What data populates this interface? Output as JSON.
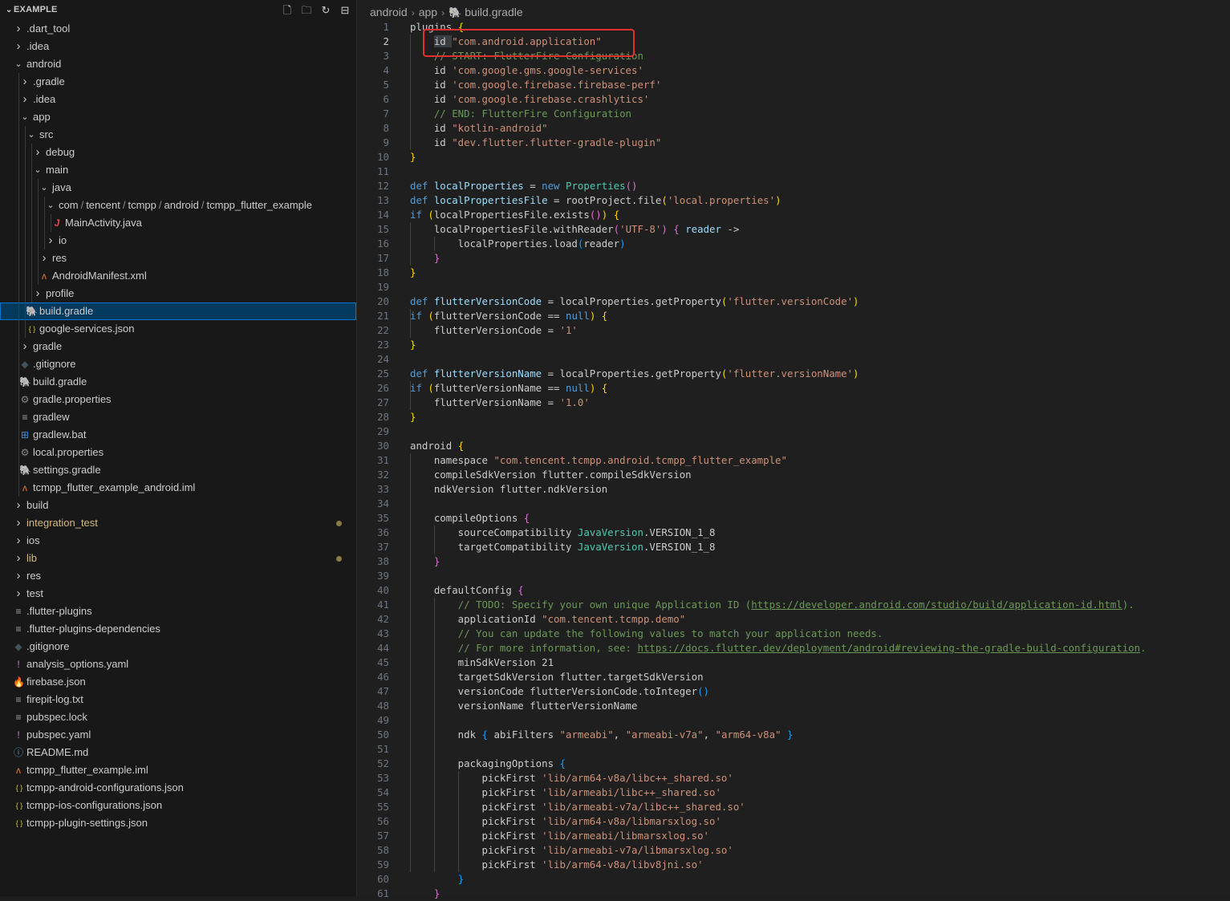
{
  "explorer": {
    "title": "EXAMPLE",
    "toolbar": [
      {
        "name": "new-file-icon",
        "glyph": "🗋"
      },
      {
        "name": "new-folder-icon",
        "glyph": "🗀"
      },
      {
        "name": "refresh-icon",
        "glyph": "↻"
      },
      {
        "name": "collapse-all-icon",
        "glyph": "⊟"
      }
    ],
    "items": [
      {
        "label": ".dart_tool",
        "kind": "folder",
        "expanded": false,
        "depth": 0
      },
      {
        "label": ".idea",
        "kind": "folder",
        "expanded": false,
        "depth": 0
      },
      {
        "label": "android",
        "kind": "folder",
        "expanded": true,
        "depth": 0
      },
      {
        "label": ".gradle",
        "kind": "folder",
        "expanded": false,
        "depth": 1
      },
      {
        "label": ".idea",
        "kind": "folder",
        "expanded": false,
        "depth": 1
      },
      {
        "label": "app",
        "kind": "folder",
        "expanded": true,
        "depth": 1
      },
      {
        "label": "src",
        "kind": "folder",
        "expanded": true,
        "depth": 2
      },
      {
        "label": "debug",
        "kind": "folder",
        "expanded": false,
        "depth": 3
      },
      {
        "label": "main",
        "kind": "folder",
        "expanded": true,
        "depth": 3
      },
      {
        "label": "java",
        "kind": "folder",
        "expanded": true,
        "depth": 4
      },
      {
        "label": "com / tencent / tcmpp / android / tcmpp_flutter_example",
        "kind": "folder",
        "expanded": true,
        "depth": 5
      },
      {
        "label": "MainActivity.java",
        "kind": "file",
        "icon": "java-icon",
        "glyph": "J",
        "color": "#e2494f",
        "depth": 6
      },
      {
        "label": "io",
        "kind": "folder",
        "expanded": false,
        "depth": 5
      },
      {
        "label": "res",
        "kind": "folder",
        "expanded": false,
        "depth": 4
      },
      {
        "label": "AndroidManifest.xml",
        "kind": "file",
        "icon": "rss-xml-icon",
        "glyph": "ʌ",
        "color": "#e37933",
        "depth": 4
      },
      {
        "label": "profile",
        "kind": "folder",
        "expanded": false,
        "depth": 3
      },
      {
        "label": "build.gradle",
        "kind": "file",
        "icon": "gradle-elephant-icon",
        "glyph": "🐘",
        "color": "#5b9bd5",
        "depth": 2,
        "selected": true
      },
      {
        "label": "google-services.json",
        "kind": "file",
        "icon": "json-braces-icon",
        "glyph": "{ }",
        "color": "#cbcb41",
        "depth": 2
      },
      {
        "label": "gradle",
        "kind": "folder",
        "expanded": false,
        "depth": 1
      },
      {
        "label": ".gitignore",
        "kind": "file",
        "icon": "git-diamond-icon",
        "glyph": "◆",
        "color": "#41535b",
        "depth": 1
      },
      {
        "label": "build.gradle",
        "kind": "file",
        "icon": "gradle-elephant-icon",
        "glyph": "🐘",
        "color": "#5b9bd5",
        "depth": 1
      },
      {
        "label": "gradle.properties",
        "kind": "file",
        "icon": "gear-icon",
        "glyph": "⚙",
        "color": "#8a8a8a",
        "depth": 1
      },
      {
        "label": "gradlew",
        "kind": "file",
        "icon": "text-lines-icon",
        "glyph": "≡",
        "color": "#a0a0a0",
        "depth": 1
      },
      {
        "label": "gradlew.bat",
        "kind": "file",
        "icon": "windows-icon",
        "glyph": "⊞",
        "color": "#3b8ee0",
        "depth": 1
      },
      {
        "label": "local.properties",
        "kind": "file",
        "icon": "gear-icon",
        "glyph": "⚙",
        "color": "#8a8a8a",
        "depth": 1
      },
      {
        "label": "settings.gradle",
        "kind": "file",
        "icon": "gradle-elephant-icon",
        "glyph": "🐘",
        "color": "#5b9bd5",
        "depth": 1
      },
      {
        "label": "tcmpp_flutter_example_android.iml",
        "kind": "file",
        "icon": "rss-xml-icon",
        "glyph": "ʌ",
        "color": "#e37933",
        "depth": 1
      },
      {
        "label": "build",
        "kind": "folder",
        "expanded": false,
        "depth": 0
      },
      {
        "label": "integration_test",
        "kind": "folder",
        "expanded": false,
        "depth": 0,
        "modified": true
      },
      {
        "label": "ios",
        "kind": "folder",
        "expanded": false,
        "depth": 0
      },
      {
        "label": "lib",
        "kind": "folder",
        "expanded": false,
        "depth": 0,
        "modified": true
      },
      {
        "label": "res",
        "kind": "folder",
        "expanded": false,
        "depth": 0
      },
      {
        "label": "test",
        "kind": "folder",
        "expanded": false,
        "depth": 0
      },
      {
        "label": ".flutter-plugins",
        "kind": "file",
        "icon": "text-lines-icon",
        "glyph": "≡",
        "color": "#a0a0a0",
        "depth": 0
      },
      {
        "label": ".flutter-plugins-dependencies",
        "kind": "file",
        "icon": "text-lines-icon",
        "glyph": "≡",
        "color": "#a0a0a0",
        "depth": 0
      },
      {
        "label": ".gitignore",
        "kind": "file",
        "icon": "git-diamond-icon",
        "glyph": "◆",
        "color": "#41535b",
        "depth": 0
      },
      {
        "label": "analysis_options.yaml",
        "kind": "file",
        "icon": "yaml-exclamation-icon",
        "glyph": "!",
        "color": "#c678dd",
        "depth": 0
      },
      {
        "label": "firebase.json",
        "kind": "file",
        "icon": "firebase-flame-icon",
        "glyph": "🔥",
        "color": "#f5820d",
        "depth": 0
      },
      {
        "label": "firepit-log.txt",
        "kind": "file",
        "icon": "text-lines-icon",
        "glyph": "≡",
        "color": "#a0a0a0",
        "depth": 0
      },
      {
        "label": "pubspec.lock",
        "kind": "file",
        "icon": "text-lines-icon",
        "glyph": "≡",
        "color": "#a0a0a0",
        "depth": 0
      },
      {
        "label": "pubspec.yaml",
        "kind": "file",
        "icon": "yaml-exclamation-icon",
        "glyph": "!",
        "color": "#c678dd",
        "depth": 0
      },
      {
        "label": "README.md",
        "kind": "file",
        "icon": "info-icon",
        "glyph": "ⓘ",
        "color": "#519aba",
        "depth": 0
      },
      {
        "label": "tcmpp_flutter_example.iml",
        "kind": "file",
        "icon": "rss-xml-icon",
        "glyph": "ʌ",
        "color": "#e37933",
        "depth": 0
      },
      {
        "label": "tcmpp-android-configurations.json",
        "kind": "file",
        "icon": "json-braces-icon",
        "glyph": "{ }",
        "color": "#cbcb41",
        "depth": 0
      },
      {
        "label": "tcmpp-ios-configurations.json",
        "kind": "file",
        "icon": "json-braces-icon",
        "glyph": "{ }",
        "color": "#cbcb41",
        "depth": 0
      },
      {
        "label": "tcmpp-plugin-settings.json",
        "kind": "file",
        "icon": "json-braces-icon",
        "glyph": "{ }",
        "color": "#cbcb41",
        "depth": 0
      }
    ]
  },
  "breadcrumb": {
    "parts": [
      "android",
      "app"
    ],
    "file": "build.gradle",
    "file_icon": "gradle-elephant-icon"
  },
  "editor": {
    "active_line": 2,
    "highlighted_line": 2,
    "colors": {
      "highlight_box": "#e03030",
      "selection": "#04395e",
      "modified": "#d7ba7d"
    },
    "lines": [
      [
        [
          "t-plain",
          "plugins "
        ],
        [
          "t-b1",
          "{"
        ]
      ],
      [
        [
          "t-plain",
          "    "
        ],
        [
          "t-sel",
          "id "
        ],
        [
          "t-str",
          "\"com.android.application\""
        ]
      ],
      [
        [
          "t-plain",
          "    "
        ],
        [
          "t-com",
          "// START: FlutterFire Configuration"
        ]
      ],
      [
        [
          "t-plain",
          "    id "
        ],
        [
          "t-str",
          "'com.google.gms.google-services'"
        ]
      ],
      [
        [
          "t-plain",
          "    id "
        ],
        [
          "t-str",
          "'com.google.firebase.firebase-perf'"
        ]
      ],
      [
        [
          "t-plain",
          "    id "
        ],
        [
          "t-str",
          "'com.google.firebase.crashlytics'"
        ]
      ],
      [
        [
          "t-plain",
          "    "
        ],
        [
          "t-com",
          "// END: FlutterFire Configuration"
        ]
      ],
      [
        [
          "t-plain",
          "    id "
        ],
        [
          "t-str",
          "\"kotlin-android\""
        ]
      ],
      [
        [
          "t-plain",
          "    id "
        ],
        [
          "t-str",
          "\"dev.flutter.flutter-gradle-plugin\""
        ]
      ],
      [
        [
          "t-b1",
          "}"
        ]
      ],
      [],
      [
        [
          "t-kw",
          "def "
        ],
        [
          "t-var",
          "localProperties"
        ],
        [
          "t-plain",
          " = "
        ],
        [
          "t-kw",
          "new "
        ],
        [
          "t-cls",
          "Properties"
        ],
        [
          "t-b2",
          "()"
        ]
      ],
      [
        [
          "t-kw",
          "def "
        ],
        [
          "t-var",
          "localPropertiesFile"
        ],
        [
          "t-plain",
          " = rootProject.file"
        ],
        [
          "t-b1",
          "("
        ],
        [
          "t-str",
          "'local.properties'"
        ],
        [
          "t-b1",
          ")"
        ]
      ],
      [
        [
          "t-kw",
          "if "
        ],
        [
          "t-b1",
          "("
        ],
        [
          "t-plain",
          "localPropertiesFile.exists"
        ],
        [
          "t-b2",
          "()"
        ],
        [
          "t-b1",
          ")"
        ],
        [
          "t-plain",
          " "
        ],
        [
          "t-b1",
          "{"
        ]
      ],
      [
        [
          "t-plain",
          "    localPropertiesFile.withReader"
        ],
        [
          "t-b2",
          "("
        ],
        [
          "t-str",
          "'UTF-8'"
        ],
        [
          "t-b2",
          ")"
        ],
        [
          "t-plain",
          " "
        ],
        [
          "t-b2",
          "{"
        ],
        [
          "t-plain",
          " "
        ],
        [
          "t-var",
          "reader"
        ],
        [
          "t-plain",
          " ->"
        ]
      ],
      [
        [
          "t-plain",
          "        localProperties.load"
        ],
        [
          "t-b3",
          "("
        ],
        [
          "t-plain",
          "reader"
        ],
        [
          "t-b3",
          ")"
        ]
      ],
      [
        [
          "t-plain",
          "    "
        ],
        [
          "t-b2",
          "}"
        ]
      ],
      [
        [
          "t-b1",
          "}"
        ]
      ],
      [],
      [
        [
          "t-kw",
          "def "
        ],
        [
          "t-var",
          "flutterVersionCode"
        ],
        [
          "t-plain",
          " = localProperties.getProperty"
        ],
        [
          "t-b1",
          "("
        ],
        [
          "t-str",
          "'flutter.versionCode'"
        ],
        [
          "t-b1",
          ")"
        ]
      ],
      [
        [
          "t-kw",
          "if "
        ],
        [
          "t-b1",
          "("
        ],
        [
          "t-plain",
          "flutterVersionCode == "
        ],
        [
          "t-kw",
          "null"
        ],
        [
          "t-b1",
          ")"
        ],
        [
          "t-plain",
          " "
        ],
        [
          "t-b1",
          "{"
        ]
      ],
      [
        [
          "t-plain",
          "    flutterVersionCode = "
        ],
        [
          "t-str",
          "'1'"
        ]
      ],
      [
        [
          "t-b1",
          "}"
        ]
      ],
      [],
      [
        [
          "t-kw",
          "def "
        ],
        [
          "t-var",
          "flutterVersionName"
        ],
        [
          "t-plain",
          " = localProperties.getProperty"
        ],
        [
          "t-b1",
          "("
        ],
        [
          "t-str",
          "'flutter.versionName'"
        ],
        [
          "t-b1",
          ")"
        ]
      ],
      [
        [
          "t-kw",
          "if "
        ],
        [
          "t-b1",
          "("
        ],
        [
          "t-plain",
          "flutterVersionName == "
        ],
        [
          "t-kw",
          "null"
        ],
        [
          "t-b1",
          ")"
        ],
        [
          "t-plain",
          " "
        ],
        [
          "t-b1",
          "{"
        ]
      ],
      [
        [
          "t-plain",
          "    flutterVersionName = "
        ],
        [
          "t-str",
          "'1.0'"
        ]
      ],
      [
        [
          "t-b1",
          "}"
        ]
      ],
      [],
      [
        [
          "t-plain",
          "android "
        ],
        [
          "t-b1",
          "{"
        ]
      ],
      [
        [
          "t-plain",
          "    namespace "
        ],
        [
          "t-str",
          "\"com.tencent.tcmpp.android.tcmpp_flutter_example\""
        ]
      ],
      [
        [
          "t-plain",
          "    compileSdkVersion flutter.compileSdkVersion"
        ]
      ],
      [
        [
          "t-plain",
          "    ndkVersion flutter.ndkVersion"
        ]
      ],
      [],
      [
        [
          "t-plain",
          "    compileOptions "
        ],
        [
          "t-b2",
          "{"
        ]
      ],
      [
        [
          "t-plain",
          "        sourceCompatibility "
        ],
        [
          "t-cls",
          "JavaVersion"
        ],
        [
          "t-plain",
          ".VERSION_1_8"
        ]
      ],
      [
        [
          "t-plain",
          "        targetCompatibility "
        ],
        [
          "t-cls",
          "JavaVersion"
        ],
        [
          "t-plain",
          ".VERSION_1_8"
        ]
      ],
      [
        [
          "t-plain",
          "    "
        ],
        [
          "t-b2",
          "}"
        ]
      ],
      [],
      [
        [
          "t-plain",
          "    defaultConfig "
        ],
        [
          "t-b2",
          "{"
        ]
      ],
      [
        [
          "t-plain",
          "        "
        ],
        [
          "t-com",
          "// TODO: Specify your own unique Application ID ("
        ],
        [
          "t-url",
          "https://developer.android.com/studio/build/application-id.html"
        ],
        [
          "t-com",
          ")."
        ]
      ],
      [
        [
          "t-plain",
          "        applicationId "
        ],
        [
          "t-str",
          "\"com.tencent.tcmpp.demo\""
        ]
      ],
      [
        [
          "t-plain",
          "        "
        ],
        [
          "t-com",
          "// You can update the following values to match your application needs."
        ]
      ],
      [
        [
          "t-plain",
          "        "
        ],
        [
          "t-com",
          "// For more information, see: "
        ],
        [
          "t-url",
          "https://docs.flutter.dev/deployment/android#reviewing-the-gradle-build-configuration"
        ],
        [
          "t-com",
          "."
        ]
      ],
      [
        [
          "t-plain",
          "        minSdkVersion 21"
        ]
      ],
      [
        [
          "t-plain",
          "        targetSdkVersion flutter.targetSdkVersion"
        ]
      ],
      [
        [
          "t-plain",
          "        versionCode flutterVersionCode.toInteger"
        ],
        [
          "t-b3",
          "()"
        ]
      ],
      [
        [
          "t-plain",
          "        versionName flutterVersionName"
        ]
      ],
      [],
      [
        [
          "t-plain",
          "        ndk "
        ],
        [
          "t-b3",
          "{"
        ],
        [
          "t-plain",
          " abiFilters "
        ],
        [
          "t-str",
          "\"armeabi\""
        ],
        [
          "t-plain",
          ", "
        ],
        [
          "t-str",
          "\"armeabi-v7a\""
        ],
        [
          "t-plain",
          ", "
        ],
        [
          "t-str",
          "\"arm64-v8a\""
        ],
        [
          "t-plain",
          " "
        ],
        [
          "t-b3",
          "}"
        ]
      ],
      [],
      [
        [
          "t-plain",
          "        packagingOptions "
        ],
        [
          "t-b3",
          "{"
        ]
      ],
      [
        [
          "t-plain",
          "            pickFirst "
        ],
        [
          "t-str",
          "'lib/arm64-v8a/libc++_shared.so'"
        ]
      ],
      [
        [
          "t-plain",
          "            pickFirst "
        ],
        [
          "t-str",
          "'lib/armeabi/libc++_shared.so'"
        ]
      ],
      [
        [
          "t-plain",
          "            pickFirst "
        ],
        [
          "t-str",
          "'lib/armeabi-v7a/libc++_shared.so'"
        ]
      ],
      [
        [
          "t-plain",
          "            pickFirst "
        ],
        [
          "t-str",
          "'lib/arm64-v8a/libmarsxlog.so'"
        ]
      ],
      [
        [
          "t-plain",
          "            pickFirst "
        ],
        [
          "t-str",
          "'lib/armeabi/libmarsxlog.so'"
        ]
      ],
      [
        [
          "t-plain",
          "            pickFirst "
        ],
        [
          "t-str",
          "'lib/armeabi-v7a/libmarsxlog.so'"
        ]
      ],
      [
        [
          "t-plain",
          "            pickFirst "
        ],
        [
          "t-str",
          "'lib/arm64-v8a/libv8jni.so'"
        ]
      ],
      [
        [
          "t-plain",
          "        "
        ],
        [
          "t-b3",
          "}"
        ]
      ],
      [
        [
          "t-plain",
          "    "
        ],
        [
          "t-b2",
          "}"
        ]
      ]
    ]
  }
}
